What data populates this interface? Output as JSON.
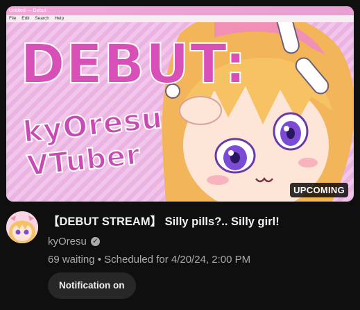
{
  "thumbnail": {
    "window_title": "Untitled — Debut",
    "menu": [
      "File",
      "Edit",
      "Search",
      "Help"
    ],
    "art_line1": "DEBUT:",
    "art_line2": "kyOresu",
    "art_line3": "VTuber",
    "badge": "UPCOMING"
  },
  "video": {
    "title": "【DEBUT STREAM】 Silly pills?.. Silly girl!",
    "channel": "kyOresu",
    "verified_icon": "check-circle-icon",
    "meta": "69 waiting • Scheduled for 4/20/24, 2:00 PM"
  },
  "actions": {
    "notify_label": "Notification on"
  },
  "colors": {
    "background": "#0f0f0f",
    "primary_text": "#f1f1f1",
    "secondary_text": "#aaaaaa",
    "button_bg": "#272727",
    "art_magenta": "#d94fb8"
  }
}
